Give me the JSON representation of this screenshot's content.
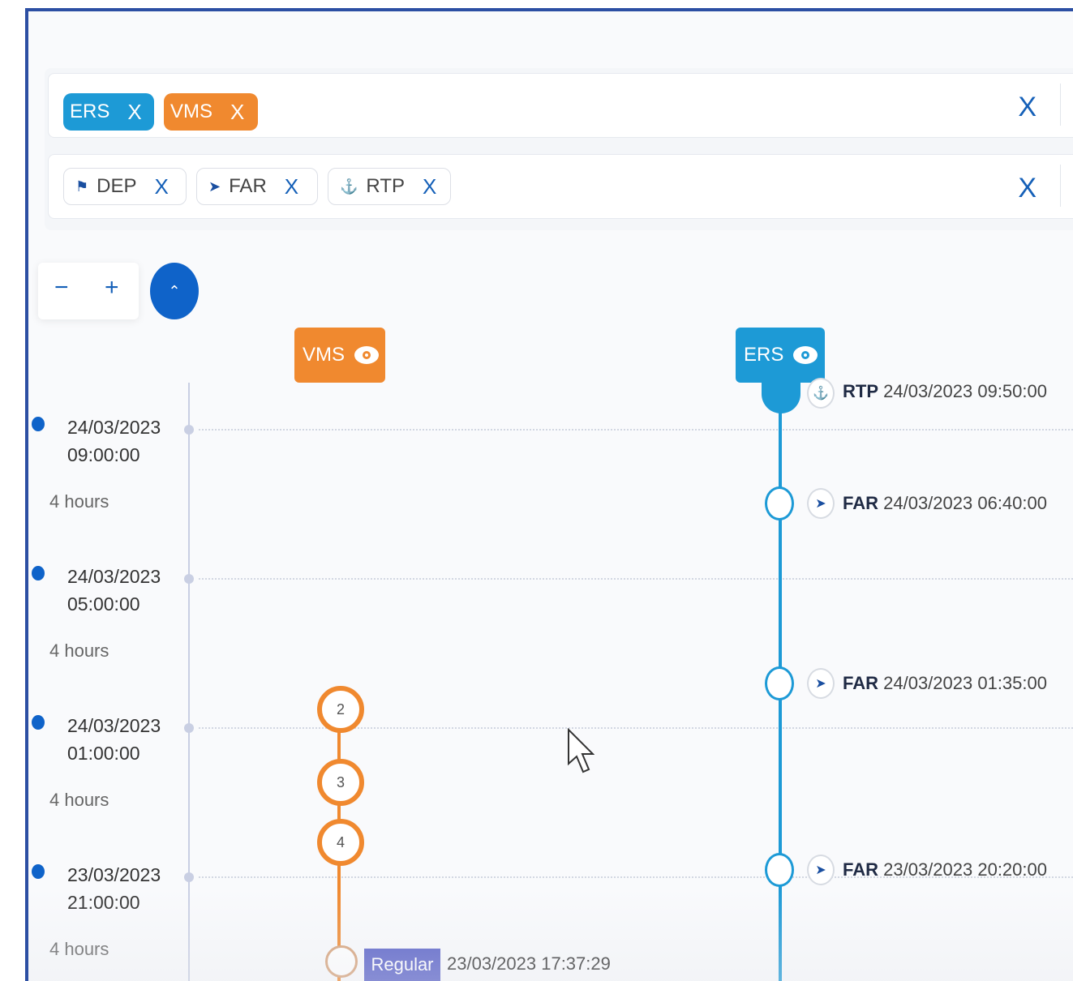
{
  "filters": {
    "sources": [
      {
        "label": "ERS",
        "remove": "X",
        "color": "#1d9ad6"
      },
      {
        "label": "VMS",
        "remove": "X",
        "color": "#f0892f"
      }
    ],
    "event_types": [
      {
        "label": "DEP",
        "icon": "flag-icon",
        "remove": "X"
      },
      {
        "label": "FAR",
        "icon": "fish-icon",
        "remove": "X"
      },
      {
        "label": "RTP",
        "icon": "anchor-icon",
        "remove": "X"
      }
    ],
    "clear_label": "X",
    "dropdown_icon": "chevron-down-icon"
  },
  "zoom": {
    "minus": "−",
    "plus": "+",
    "collapse_icon": "chevron-up-icon"
  },
  "tracks": {
    "vms": {
      "label": "VMS",
      "icon": "eye-icon",
      "color": "#f0892f"
    },
    "ers": {
      "label": "ERS",
      "icon": "eye-icon",
      "color": "#1d9ad6"
    }
  },
  "time_axis": {
    "marks": [
      {
        "date": "24/03/2023",
        "time": "09:00:00"
      },
      {
        "date": "24/03/2023",
        "time": "05:00:00"
      },
      {
        "date": "24/03/2023",
        "time": "01:00:00"
      },
      {
        "date": "23/03/2023",
        "time": "21:00:00"
      }
    ],
    "intervals": [
      "4 hours",
      "4 hours",
      "4 hours",
      "4 hours"
    ]
  },
  "vms_positions": {
    "clusters": [
      "2",
      "3",
      "4"
    ],
    "last": {
      "tag": "Regular",
      "timestamp": "23/03/2023 17:37:29"
    }
  },
  "ers_events": [
    {
      "type": "RTP",
      "icon": "anchor-icon",
      "timestamp": "24/03/2023 09:50:00"
    },
    {
      "type": "FAR",
      "icon": "fish-icon",
      "timestamp": "24/03/2023 06:40:00"
    },
    {
      "type": "FAR",
      "icon": "fish-icon",
      "timestamp": "24/03/2023 01:35:00"
    },
    {
      "type": "FAR",
      "icon": "fish-icon",
      "timestamp": "23/03/2023 20:20:00"
    }
  ]
}
